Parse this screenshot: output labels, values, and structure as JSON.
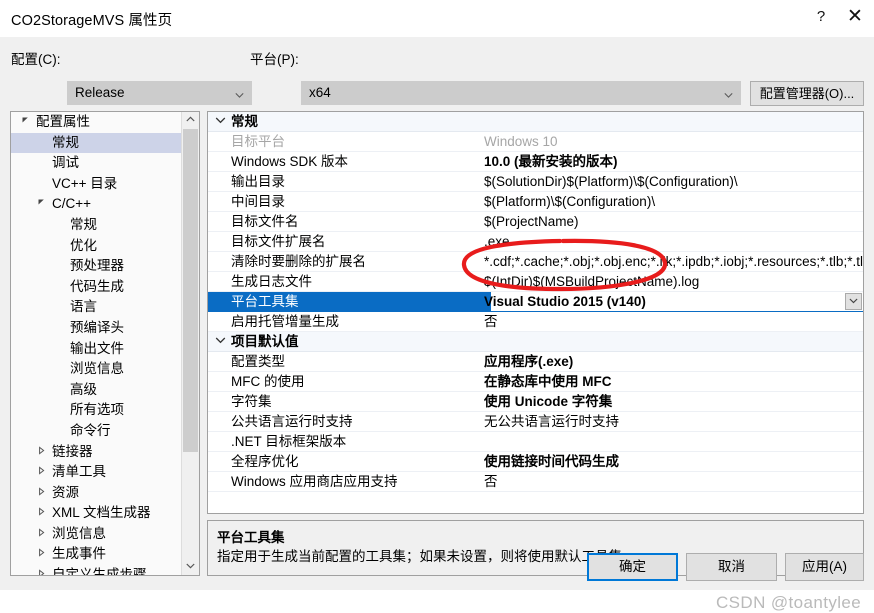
{
  "window": {
    "title": "CO2StorageMVS 属性页",
    "help_icon": "?",
    "close_icon": "✕"
  },
  "toolbar": {
    "config_label": "配置(C):",
    "config_value": "Release",
    "platform_label": "平台(P):",
    "platform_value": "x64",
    "config_manager_label": "配置管理器(O)..."
  },
  "tree": {
    "items": [
      {
        "label": "配置属性",
        "level": 0,
        "twisty": "▲",
        "expanded": true,
        "selected": false
      },
      {
        "label": "常规",
        "level": 1,
        "twisty": "",
        "expanded": false,
        "selected": true
      },
      {
        "label": "调试",
        "level": 1,
        "twisty": "",
        "expanded": false,
        "selected": false
      },
      {
        "label": "VC++ 目录",
        "level": 1,
        "twisty": "",
        "expanded": false,
        "selected": false
      },
      {
        "label": "C/C++",
        "level": 1,
        "twisty": "▲",
        "expanded": true,
        "selected": false
      },
      {
        "label": "常规",
        "level": 2,
        "twisty": "",
        "expanded": false,
        "selected": false
      },
      {
        "label": "优化",
        "level": 2,
        "twisty": "",
        "expanded": false,
        "selected": false
      },
      {
        "label": "预处理器",
        "level": 2,
        "twisty": "",
        "expanded": false,
        "selected": false
      },
      {
        "label": "代码生成",
        "level": 2,
        "twisty": "",
        "expanded": false,
        "selected": false
      },
      {
        "label": "语言",
        "level": 2,
        "twisty": "",
        "expanded": false,
        "selected": false
      },
      {
        "label": "预编译头",
        "level": 2,
        "twisty": "",
        "expanded": false,
        "selected": false
      },
      {
        "label": "输出文件",
        "level": 2,
        "twisty": "",
        "expanded": false,
        "selected": false
      },
      {
        "label": "浏览信息",
        "level": 2,
        "twisty": "",
        "expanded": false,
        "selected": false
      },
      {
        "label": "高级",
        "level": 2,
        "twisty": "",
        "expanded": false,
        "selected": false
      },
      {
        "label": "所有选项",
        "level": 2,
        "twisty": "",
        "expanded": false,
        "selected": false
      },
      {
        "label": "命令行",
        "level": 2,
        "twisty": "",
        "expanded": false,
        "selected": false
      },
      {
        "label": "链接器",
        "level": 1,
        "twisty": "▶",
        "expanded": false,
        "selected": false
      },
      {
        "label": "清单工具",
        "level": 1,
        "twisty": "▶",
        "expanded": false,
        "selected": false
      },
      {
        "label": "资源",
        "level": 1,
        "twisty": "▶",
        "expanded": false,
        "selected": false
      },
      {
        "label": "XML 文档生成器",
        "level": 1,
        "twisty": "▶",
        "expanded": false,
        "selected": false
      },
      {
        "label": "浏览信息",
        "level": 1,
        "twisty": "▶",
        "expanded": false,
        "selected": false
      },
      {
        "label": "生成事件",
        "level": 1,
        "twisty": "▶",
        "expanded": false,
        "selected": false
      },
      {
        "label": "自定义生成步骤",
        "level": 1,
        "twisty": "▶",
        "expanded": false,
        "selected": false
      }
    ],
    "scroll_up_icon": "▲",
    "scroll_down_icon": "▼"
  },
  "grid": {
    "sections": [
      {
        "type": "category",
        "label": "常规",
        "twisty": "⌄",
        "rows": [
          {
            "name": "目标平台",
            "value": "Windows 10",
            "bold": false,
            "dim": true,
            "selected": false
          },
          {
            "name": "Windows SDK 版本",
            "value": "10.0 (最新安装的版本)",
            "bold": true,
            "dim": false,
            "selected": false
          },
          {
            "name": "输出目录",
            "value": "$(SolutionDir)$(Platform)\\$(Configuration)\\",
            "bold": false,
            "dim": false,
            "selected": false
          },
          {
            "name": "中间目录",
            "value": "$(Platform)\\$(Configuration)\\",
            "bold": false,
            "dim": false,
            "selected": false
          },
          {
            "name": "目标文件名",
            "value": "$(ProjectName)",
            "bold": false,
            "dim": false,
            "selected": false
          },
          {
            "name": "目标文件扩展名",
            "value": ".exe",
            "bold": false,
            "dim": false,
            "selected": false
          },
          {
            "name": "清除时要删除的扩展名",
            "value": "*.cdf;*.cache;*.obj;*.obj.enc;*.ilk;*.ipdb;*.iobj;*.resources;*.tlb;*.tli;*.t",
            "bold": false,
            "dim": false,
            "selected": false
          },
          {
            "name": "生成日志文件",
            "value": "$(IntDir)$(MSBuildProjectName).log",
            "bold": false,
            "dim": false,
            "selected": false
          },
          {
            "name": "平台工具集",
            "value": "Visual Studio 2015 (v140)",
            "bold": true,
            "dim": false,
            "selected": true
          },
          {
            "name": "启用托管增量生成",
            "value": "否",
            "bold": false,
            "dim": false,
            "selected": false
          }
        ]
      },
      {
        "type": "category",
        "label": "项目默认值",
        "twisty": "⌄",
        "rows": [
          {
            "name": "配置类型",
            "value": "应用程序(.exe)",
            "bold": true,
            "dim": false,
            "selected": false
          },
          {
            "name": "MFC 的使用",
            "value": "在静态库中使用 MFC",
            "bold": true,
            "dim": false,
            "selected": false
          },
          {
            "name": "字符集",
            "value": "使用 Unicode 字符集",
            "bold": true,
            "dim": false,
            "selected": false
          },
          {
            "name": "公共语言运行时支持",
            "value": "无公共语言运行时支持",
            "bold": false,
            "dim": false,
            "selected": false
          },
          {
            "name": ".NET 目标框架版本",
            "value": "",
            "bold": false,
            "dim": false,
            "selected": false
          },
          {
            "name": "全程序优化",
            "value": "使用链接时间代码生成",
            "bold": true,
            "dim": false,
            "selected": false
          },
          {
            "name": "Windows 应用商店应用支持",
            "value": "否",
            "bold": false,
            "dim": false,
            "selected": false
          }
        ]
      }
    ],
    "value_dropdown_icon": "⌄"
  },
  "description": {
    "title": "平台工具集",
    "body": "指定用于生成当前配置的工具集；如果未设置，则将使用默认工具集"
  },
  "footer": {
    "ok_label": "确定",
    "cancel_label": "取消",
    "apply_label": "应用(A)"
  },
  "annotation": {
    "ellipse_color": "#e81c1c"
  },
  "watermark": {
    "text": "CSDN @toantylee"
  }
}
